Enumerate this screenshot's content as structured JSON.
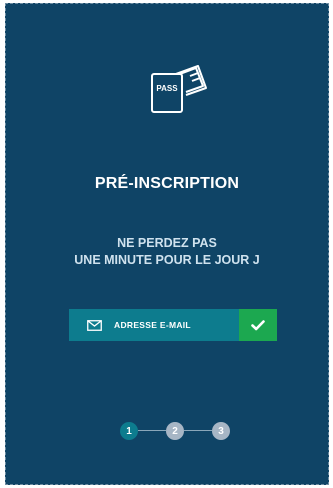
{
  "icon": {
    "name": "pass-card-icon",
    "label": "PASS"
  },
  "title": "PRÉ-INSCRIPTION",
  "subtitle": [
    "NE PERDEZ PAS",
    "UNE MINUTE POUR LE JOUR J"
  ],
  "email": {
    "placeholder": "ADRESSE E-MAIL",
    "icon": "mail-icon",
    "submit_icon": "check-icon"
  },
  "steps": [
    {
      "label": "1",
      "state": "active"
    },
    {
      "label": "2",
      "state": "inactive"
    },
    {
      "label": "3",
      "state": "inactive"
    }
  ],
  "colors": {
    "background": "#0f4466",
    "accent_teal": "#0d7c8e",
    "submit_green": "#1ca850",
    "step_inactive": "#a7b6c5"
  }
}
